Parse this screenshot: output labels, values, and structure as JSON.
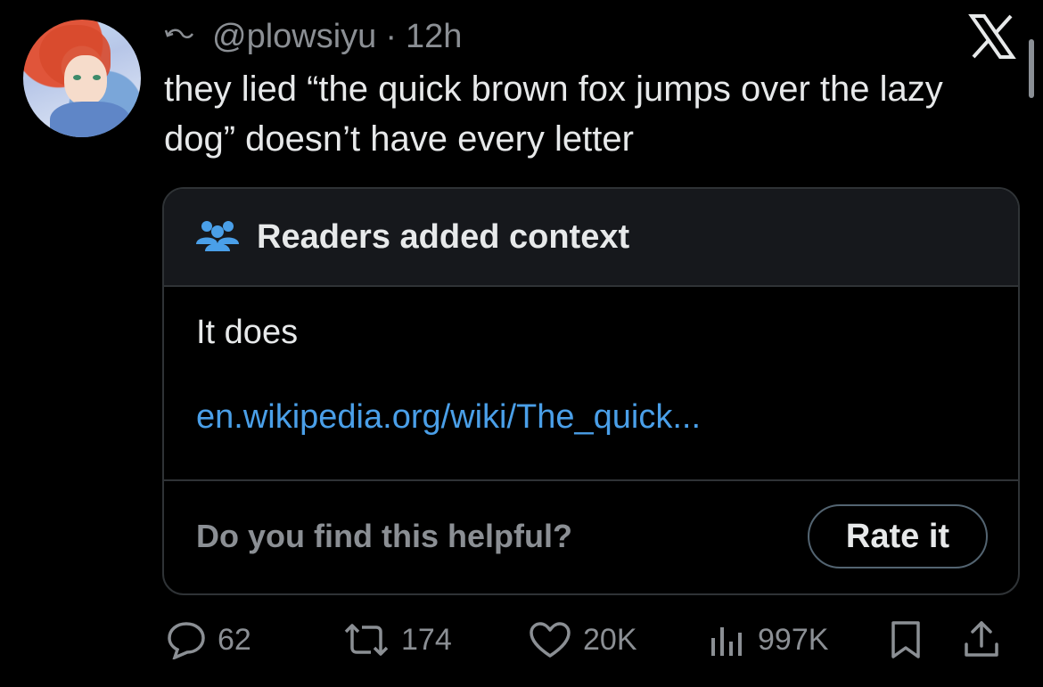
{
  "tweet": {
    "handle": "@plowsiyu",
    "separator": "·",
    "time": "12h",
    "text": "they lied “the quick brown fox jumps over the lazy dog” doesn’t have every letter"
  },
  "note": {
    "header": "Readers added context",
    "text": "It does",
    "link": "en.wikipedia.org/wiki/The_quick...",
    "question": "Do you find this helpful?",
    "rate_label": "Rate it"
  },
  "stats": {
    "replies": "62",
    "reposts": "174",
    "likes": "20K",
    "views": "997K"
  },
  "icons": [
    "reply-arrow-icon",
    "x-logo-icon",
    "community-icon",
    "reply-icon",
    "repost-icon",
    "like-icon",
    "views-icon",
    "bookmark-icon",
    "share-icon"
  ],
  "colors": {
    "background": "#000000",
    "text": "#e7e9ea",
    "muted": "#8b8f94",
    "link": "#4a9fe8"
  }
}
